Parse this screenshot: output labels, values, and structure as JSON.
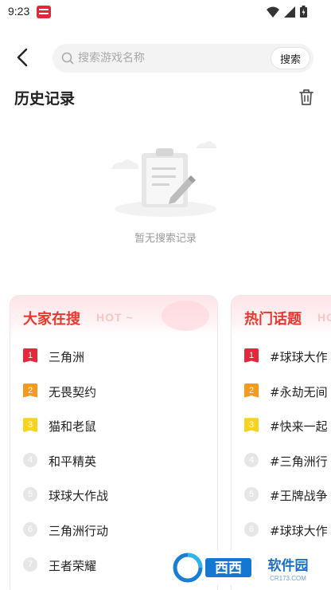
{
  "status": {
    "time": "9:23"
  },
  "search": {
    "placeholder": "搜索游戏名称",
    "value": "",
    "button_label": "搜索"
  },
  "history": {
    "title": "历史记录",
    "empty_text": "暂无搜索记录"
  },
  "hot_search": {
    "title": "大家在搜",
    "tag": "HOT ~",
    "items": [
      {
        "rank": "1",
        "label": "三角洲"
      },
      {
        "rank": "2",
        "label": "无畏契约"
      },
      {
        "rank": "3",
        "label": "猫和老鼠"
      },
      {
        "rank": "4",
        "label": "和平精英"
      },
      {
        "rank": "5",
        "label": "球球大作战"
      },
      {
        "rank": "6",
        "label": "三角洲行动"
      },
      {
        "rank": "7",
        "label": "王者荣耀"
      }
    ]
  },
  "hot_topics": {
    "title": "热门话题",
    "tag": "HO",
    "items": [
      {
        "rank": "1",
        "label": "#球球大作"
      },
      {
        "rank": "2",
        "label": "#永劫无间"
      },
      {
        "rank": "3",
        "label": "#快来一起"
      },
      {
        "rank": "4",
        "label": "#三角洲行"
      },
      {
        "rank": "5",
        "label": "#王牌战争"
      },
      {
        "rank": "6",
        "label": "#球球大作"
      },
      {
        "rank": "7",
        "label": ""
      }
    ]
  },
  "watermark": {
    "brand": "西西软件园",
    "site": "CR173.COM"
  },
  "colors": {
    "accent": "#e8382e",
    "rank1": "#e4283c",
    "rank2": "#f39a1f",
    "rank3": "#f7d21e"
  }
}
